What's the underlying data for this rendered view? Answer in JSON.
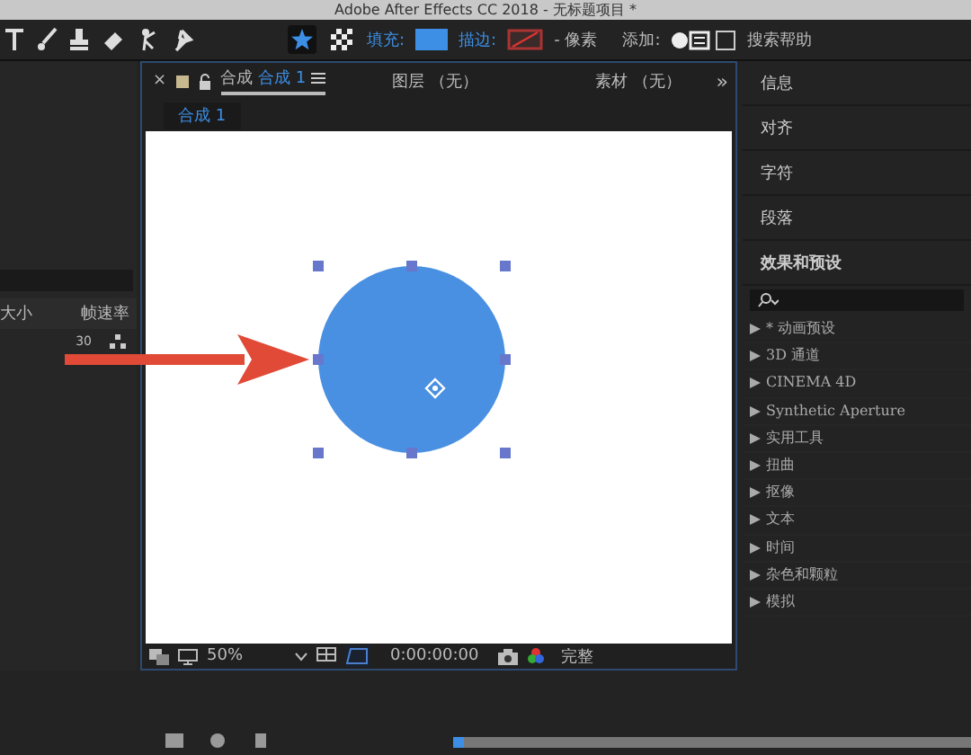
{
  "window": {
    "title": "Adobe After Effects CC 2018 - 无标题项目 *"
  },
  "toolbar": {
    "tools": [
      {
        "kind": "text"
      },
      {
        "kind": "brush"
      },
      {
        "kind": "stamp"
      },
      {
        "kind": "eraser"
      },
      {
        "kind": "puppet"
      },
      {
        "kind": "pin"
      }
    ],
    "shape_modes": [
      {
        "kind": "star",
        "selected": true
      },
      {
        "kind": "grid",
        "selected": false
      }
    ],
    "fill": {
      "label": "填充:",
      "color": "#3d8fe6"
    },
    "stroke": {
      "label": "描边:"
    },
    "stroke_width": "- 像素",
    "add_label": "添加:",
    "search_help": {
      "label": "搜索帮助",
      "checked": false
    }
  },
  "left_panel": {
    "columns": [
      "大小",
      "帧速率"
    ],
    "rows": [
      {
        "frame_rate": "30"
      }
    ]
  },
  "composition": {
    "close": "×",
    "tab": {
      "prefix": "合成",
      "name": "合成 1"
    },
    "tabs": [
      "图层 （无）",
      "素材 （无）"
    ],
    "overflow": "»",
    "breadcrumb": "合成 1",
    "shape": {
      "color": "#4a90e2"
    },
    "footer": {
      "zoom": "50%",
      "timecode": "0:00:00:00",
      "resolution": "完整"
    }
  },
  "annotation": {
    "color": "#e04a36"
  },
  "right_panel": {
    "sections": [
      "信息",
      "对齐",
      "字符",
      "段落"
    ],
    "effects_title": "效果和预设",
    "effects": [
      "* 动画预设",
      "3D 通道",
      "CINEMA 4D",
      "Synthetic Aperture",
      "实用工具",
      "扭曲",
      "抠像",
      "文本",
      "时间",
      "杂色和颗粒",
      "模拟"
    ]
  },
  "timeline": {
    "level": 0.0
  }
}
